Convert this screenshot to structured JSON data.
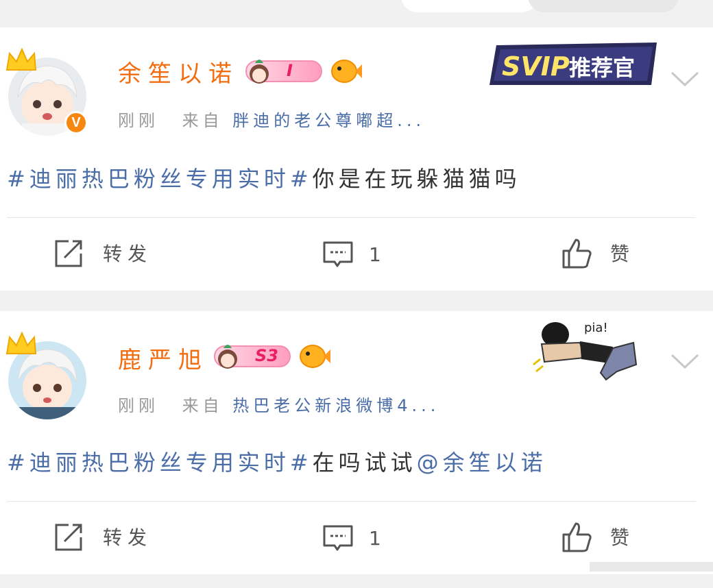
{
  "posts": [
    {
      "username": "余笙以诺",
      "level": "I",
      "time": "刚刚",
      "from_label": "来自",
      "source": "胖迪的老公尊嘟超...",
      "hashtag": "#迪丽热巴粉丝专用实时#",
      "text": "你是在玩躲猫猫吗",
      "mention": "",
      "actions": {
        "repost": "转发",
        "comment_count": "1",
        "like": "赞"
      },
      "badge": "SVIP推荐官"
    },
    {
      "username": "鹿严旭",
      "level": "S3",
      "time": "刚刚",
      "from_label": "来自",
      "source": "热巴老公新浪微博4...",
      "hashtag": "#迪丽热巴粉丝专用实时#",
      "text": "在吗试试",
      "mention": "@余笙以诺",
      "actions": {
        "repost": "转发",
        "comment_count": "1",
        "like": "赞"
      },
      "sticker_text": "pia!"
    }
  ],
  "colors": {
    "username": "#f26d10",
    "link": "#4a6da7",
    "vip": "#f7870f"
  },
  "icons": [
    "crown-icon",
    "verified-v-icon",
    "fish-icon",
    "repost-icon",
    "comment-icon",
    "like-icon",
    "chevron-down-icon"
  ]
}
